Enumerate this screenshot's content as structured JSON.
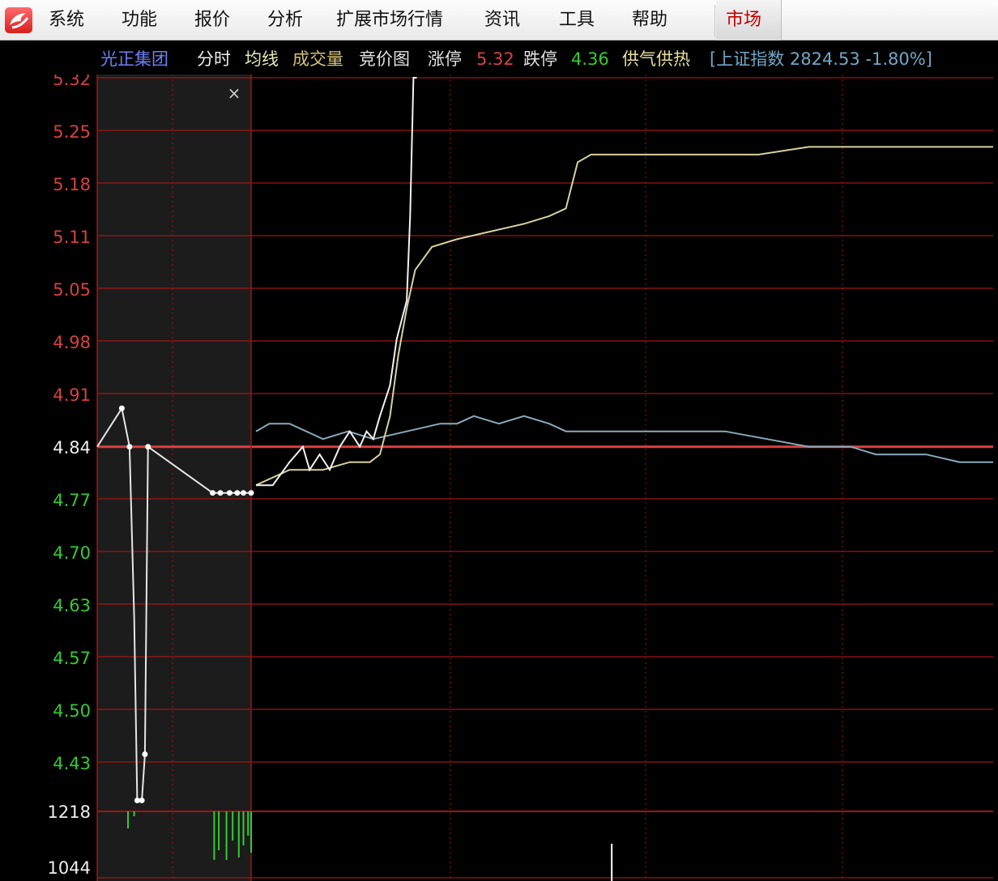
{
  "menubar": {
    "items": [
      "系统",
      "功能",
      "报价",
      "分析",
      "扩展市场行情",
      "资讯",
      "工具",
      "帮助"
    ],
    "market_tab": "市场"
  },
  "infobar": {
    "stock_name": "光正集团",
    "tabs": [
      "分时",
      "均线",
      "成交量",
      "竞价图"
    ],
    "limit_up_label": "涨停",
    "limit_up_value": "5.32",
    "limit_down_label": "跌停",
    "limit_down_value": "4.36",
    "supply_heat": "供气供热",
    "index_text": "[上证指数 2824.53 -1.80%]"
  },
  "colors": {
    "up": "#d94040",
    "down": "#33cc33",
    "grid": "#a01515",
    "price_line": "#e6e6e6",
    "avg_line": "#d8d0a0",
    "index_line": "#88aabb",
    "auction_bg": "#1c1c1c"
  },
  "chart_data": {
    "type": "line",
    "y_ticks": [
      "5.32",
      "5.25",
      "5.18",
      "5.11",
      "5.05",
      "4.98",
      "4.91",
      "4.84",
      "4.77",
      "4.70",
      "4.63",
      "4.57",
      "4.50",
      "4.43"
    ],
    "prev_close": 4.84,
    "ylim": [
      4.36,
      5.32
    ],
    "volume_ticks": [
      "1218",
      "1044"
    ],
    "close_button": "×",
    "auction_price": [
      {
        "t": 0,
        "p": 4.84
      },
      {
        "t": 0.16,
        "p": 4.89
      },
      {
        "t": 0.21,
        "p": 4.84
      },
      {
        "t": 0.24,
        "p": 4.62
      },
      {
        "t": 0.26,
        "p": 4.38
      },
      {
        "t": 0.29,
        "p": 4.38
      },
      {
        "t": 0.31,
        "p": 4.44
      },
      {
        "t": 0.33,
        "p": 4.84
      },
      {
        "t": 0.75,
        "p": 4.78
      },
      {
        "t": 0.8,
        "p": 4.78
      },
      {
        "t": 0.86,
        "p": 4.78
      },
      {
        "t": 0.91,
        "p": 4.78
      },
      {
        "t": 0.95,
        "p": 4.78
      },
      {
        "t": 1.0,
        "p": 4.78
      }
    ],
    "auction_markers": [
      0.16,
      0.21,
      0.26,
      0.29,
      0.31,
      0.33,
      0.75,
      0.8,
      0.86,
      0.91,
      0.95,
      1.0
    ],
    "auction_volume": [
      {
        "t": 0.2,
        "v": 0.35
      },
      {
        "t": 0.24,
        "v": 0.1
      },
      {
        "t": 0.76,
        "v": 1.0
      },
      {
        "t": 0.79,
        "v": 0.8
      },
      {
        "t": 0.84,
        "v": 1.0
      },
      {
        "t": 0.88,
        "v": 0.6
      },
      {
        "t": 0.92,
        "v": 0.95
      },
      {
        "t": 0.95,
        "v": 0.7
      },
      {
        "t": 0.98,
        "v": 0.5
      },
      {
        "t": 1.0,
        "v": 0.85
      }
    ],
    "price": [
      {
        "t": 0,
        "p": 4.79
      },
      {
        "t": 10,
        "p": 4.79
      },
      {
        "t": 20,
        "p": 4.82
      },
      {
        "t": 28,
        "p": 4.84
      },
      {
        "t": 32,
        "p": 4.81
      },
      {
        "t": 38,
        "p": 4.83
      },
      {
        "t": 44,
        "p": 4.81
      },
      {
        "t": 50,
        "p": 4.84
      },
      {
        "t": 56,
        "p": 4.86
      },
      {
        "t": 62,
        "p": 4.84
      },
      {
        "t": 66,
        "p": 4.86
      },
      {
        "t": 70,
        "p": 4.85
      },
      {
        "t": 74,
        "p": 4.88
      },
      {
        "t": 80,
        "p": 4.92
      },
      {
        "t": 84,
        "p": 4.98
      },
      {
        "t": 90,
        "p": 5.03
      },
      {
        "t": 92,
        "p": 5.14
      },
      {
        "t": 94,
        "p": 5.32
      },
      {
        "t": 96,
        "p": 5.32
      }
    ],
    "avg_price": [
      {
        "t": 0,
        "p": 4.79
      },
      {
        "t": 20,
        "p": 4.81
      },
      {
        "t": 40,
        "p": 4.81
      },
      {
        "t": 56,
        "p": 4.82
      },
      {
        "t": 68,
        "p": 4.82
      },
      {
        "t": 74,
        "p": 4.83
      },
      {
        "t": 80,
        "p": 4.88
      },
      {
        "t": 85,
        "p": 4.96
      },
      {
        "t": 90,
        "p": 5.02
      },
      {
        "t": 95,
        "p": 5.07
      },
      {
        "t": 105,
        "p": 5.1
      },
      {
        "t": 120,
        "p": 5.11
      },
      {
        "t": 140,
        "p": 5.12
      },
      {
        "t": 160,
        "p": 5.13
      },
      {
        "t": 175,
        "p": 5.14
      },
      {
        "t": 185,
        "p": 5.15
      },
      {
        "t": 192,
        "p": 5.21
      },
      {
        "t": 200,
        "p": 5.22
      },
      {
        "t": 230,
        "p": 5.22
      },
      {
        "t": 260,
        "p": 5.22
      },
      {
        "t": 280,
        "p": 5.22
      },
      {
        "t": 300,
        "p": 5.22
      },
      {
        "t": 330,
        "p": 5.23
      },
      {
        "t": 360,
        "p": 5.23
      },
      {
        "t": 400,
        "p": 5.23
      },
      {
        "t": 440,
        "p": 5.23
      }
    ],
    "index_line": [
      {
        "t": 0,
        "p": 4.86
      },
      {
        "t": 8,
        "p": 4.87
      },
      {
        "t": 20,
        "p": 4.87
      },
      {
        "t": 30,
        "p": 4.86
      },
      {
        "t": 40,
        "p": 4.85
      },
      {
        "t": 55,
        "p": 4.86
      },
      {
        "t": 70,
        "p": 4.85
      },
      {
        "t": 90,
        "p": 4.86
      },
      {
        "t": 110,
        "p": 4.87
      },
      {
        "t": 120,
        "p": 4.87
      },
      {
        "t": 130,
        "p": 4.88
      },
      {
        "t": 145,
        "p": 4.87
      },
      {
        "t": 160,
        "p": 4.88
      },
      {
        "t": 175,
        "p": 4.87
      },
      {
        "t": 185,
        "p": 4.86
      },
      {
        "t": 200,
        "p": 4.86
      },
      {
        "t": 230,
        "p": 4.86
      },
      {
        "t": 255,
        "p": 4.86
      },
      {
        "t": 280,
        "p": 4.86
      },
      {
        "t": 305,
        "p": 4.85
      },
      {
        "t": 330,
        "p": 4.84
      },
      {
        "t": 355,
        "p": 4.84
      },
      {
        "t": 370,
        "p": 4.83
      },
      {
        "t": 380,
        "p": 4.83
      },
      {
        "t": 400,
        "p": 4.83
      },
      {
        "t": 420,
        "p": 4.82
      },
      {
        "t": 440,
        "p": 4.82
      }
    ],
    "session_length": 440,
    "volume": [
      {
        "t": 164,
        "v": 1.0
      }
    ]
  }
}
